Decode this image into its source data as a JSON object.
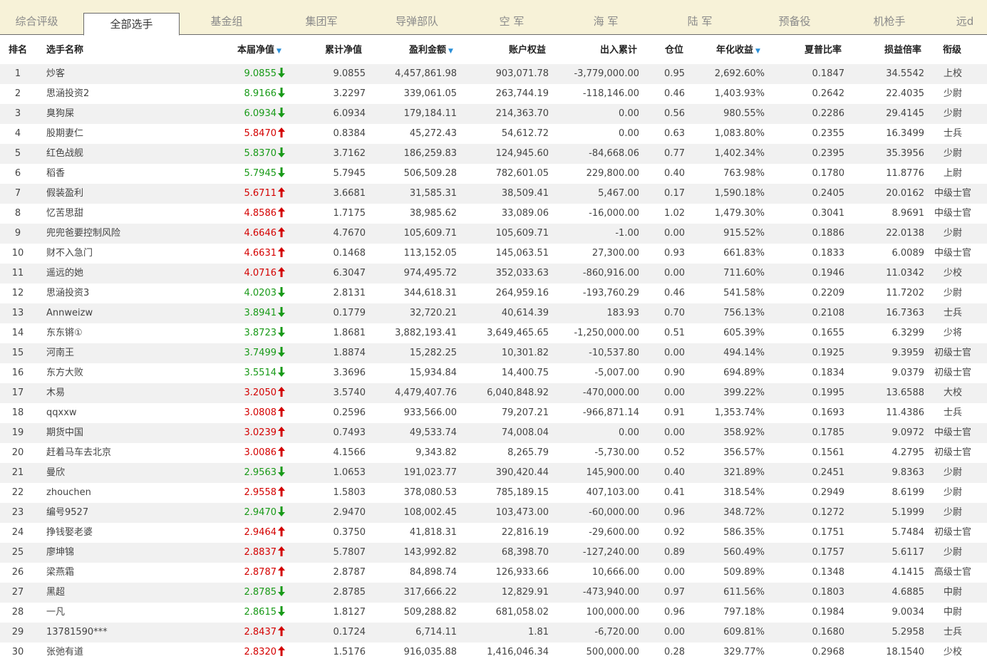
{
  "tabs": [
    "综合评级",
    "全部选手",
    "基金组",
    "集团军",
    "导弹部队",
    "空 军",
    "海 军",
    "陆 军",
    "预备役",
    "机枪手",
    "远d"
  ],
  "active_tab": 1,
  "headers": {
    "rank": "排名",
    "name": "选手名称",
    "nav": "本届净值",
    "cum_nav": "累计净值",
    "profit": "盈利金额",
    "equity": "账户权益",
    "inout": "出入累计",
    "position": "仓位",
    "annual": "年化收益",
    "sharpe": "夏普比率",
    "pl_ratio": "损益倍率",
    "title": "衔级"
  },
  "colors": {
    "up": "#d40000",
    "down": "#189a18",
    "tab_bg": "#f7f2d8",
    "row_alt": "#f1f1f1",
    "sort_arrow": "#2a8fd8"
  },
  "rows": [
    {
      "rank": "1",
      "name": "炒客",
      "nav": "9.0855",
      "dir": "down",
      "cum_nav": "9.0855",
      "profit": "4,457,861.98",
      "equity": "903,071.78",
      "inout": "-3,779,000.00",
      "position": "0.95",
      "annual": "2,692.60%",
      "sharpe": "0.1847",
      "pl_ratio": "34.5542",
      "title": "上校"
    },
    {
      "rank": "2",
      "name": "思涵投资2",
      "nav": "8.9166",
      "dir": "down",
      "cum_nav": "3.2297",
      "profit": "339,061.05",
      "equity": "263,744.19",
      "inout": "-118,146.00",
      "position": "0.46",
      "annual": "1,403.93%",
      "sharpe": "0.2642",
      "pl_ratio": "22.4035",
      "title": "少尉"
    },
    {
      "rank": "3",
      "name": "臭狗屎",
      "nav": "6.0934",
      "dir": "down",
      "cum_nav": "6.0934",
      "profit": "179,184.11",
      "equity": "214,363.70",
      "inout": "0.00",
      "position": "0.56",
      "annual": "980.55%",
      "sharpe": "0.2286",
      "pl_ratio": "29.4145",
      "title": "少尉"
    },
    {
      "rank": "4",
      "name": "股期妻仁",
      "nav": "5.8470",
      "dir": "up",
      "cum_nav": "0.8384",
      "profit": "45,272.43",
      "equity": "54,612.72",
      "inout": "0.00",
      "position": "0.63",
      "annual": "1,083.80%",
      "sharpe": "0.2355",
      "pl_ratio": "16.3499",
      "title": "士兵"
    },
    {
      "rank": "5",
      "name": "红色战舰",
      "nav": "5.8370",
      "dir": "down",
      "cum_nav": "3.7162",
      "profit": "186,259.83",
      "equity": "124,945.60",
      "inout": "-84,668.06",
      "position": "0.77",
      "annual": "1,402.34%",
      "sharpe": "0.2395",
      "pl_ratio": "35.3956",
      "title": "少尉"
    },
    {
      "rank": "6",
      "name": "稻香",
      "nav": "5.7945",
      "dir": "down",
      "cum_nav": "5.7945",
      "profit": "506,509.28",
      "equity": "782,601.05",
      "inout": "229,800.00",
      "position": "0.40",
      "annual": "763.98%",
      "sharpe": "0.1780",
      "pl_ratio": "11.8776",
      "title": "上尉"
    },
    {
      "rank": "7",
      "name": "假装盈利",
      "nav": "5.6711",
      "dir": "up",
      "cum_nav": "3.6681",
      "profit": "31,585.31",
      "equity": "38,509.41",
      "inout": "5,467.00",
      "position": "0.17",
      "annual": "1,590.18%",
      "sharpe": "0.2405",
      "pl_ratio": "20.0162",
      "title": "中级士官"
    },
    {
      "rank": "8",
      "name": "忆苦思甜",
      "nav": "4.8586",
      "dir": "up",
      "cum_nav": "1.7175",
      "profit": "38,985.62",
      "equity": "33,089.06",
      "inout": "-16,000.00",
      "position": "1.02",
      "annual": "1,479.30%",
      "sharpe": "0.3041",
      "pl_ratio": "8.9691",
      "title": "中级士官"
    },
    {
      "rank": "9",
      "name": "兜兜爸要控制风险",
      "nav": "4.6646",
      "dir": "up",
      "cum_nav": "4.7670",
      "profit": "105,609.71",
      "equity": "105,609.71",
      "inout": "-1.00",
      "position": "0.00",
      "annual": "915.52%",
      "sharpe": "0.1886",
      "pl_ratio": "22.0138",
      "title": "少尉"
    },
    {
      "rank": "10",
      "name": "财不入急门",
      "nav": "4.6631",
      "dir": "up",
      "cum_nav": "0.1468",
      "profit": "113,152.05",
      "equity": "145,063.51",
      "inout": "27,300.00",
      "position": "0.93",
      "annual": "661.83%",
      "sharpe": "0.1833",
      "pl_ratio": "6.0089",
      "title": "中级士官"
    },
    {
      "rank": "11",
      "name": "遥远的她",
      "nav": "4.0716",
      "dir": "up",
      "cum_nav": "6.3047",
      "profit": "974,495.72",
      "equity": "352,033.63",
      "inout": "-860,916.00",
      "position": "0.00",
      "annual": "711.60%",
      "sharpe": "0.1946",
      "pl_ratio": "11.0342",
      "title": "少校"
    },
    {
      "rank": "12",
      "name": "思涵投资3",
      "nav": "4.0203",
      "dir": "down",
      "cum_nav": "2.8131",
      "profit": "344,618.31",
      "equity": "264,959.16",
      "inout": "-193,760.29",
      "position": "0.46",
      "annual": "541.58%",
      "sharpe": "0.2209",
      "pl_ratio": "11.7202",
      "title": "少尉"
    },
    {
      "rank": "13",
      "name": "Annweizw",
      "nav": "3.8941",
      "dir": "down",
      "cum_nav": "0.1779",
      "profit": "32,720.21",
      "equity": "40,614.39",
      "inout": "183.93",
      "position": "0.70",
      "annual": "756.13%",
      "sharpe": "0.2108",
      "pl_ratio": "16.7363",
      "title": "士兵"
    },
    {
      "rank": "14",
      "name": "东东锵①",
      "nav": "3.8723",
      "dir": "down",
      "cum_nav": "1.8681",
      "profit": "3,882,193.41",
      "equity": "3,649,465.65",
      "inout": "-1,250,000.00",
      "position": "0.51",
      "annual": "605.39%",
      "sharpe": "0.1655",
      "pl_ratio": "6.3299",
      "title": "少将"
    },
    {
      "rank": "15",
      "name": "河南王",
      "nav": "3.7499",
      "dir": "down",
      "cum_nav": "1.8874",
      "profit": "15,282.25",
      "equity": "10,301.82",
      "inout": "-10,537.80",
      "position": "0.00",
      "annual": "494.14%",
      "sharpe": "0.1925",
      "pl_ratio": "9.3959",
      "title": "初级士官"
    },
    {
      "rank": "16",
      "name": "东方大败",
      "nav": "3.5514",
      "dir": "down",
      "cum_nav": "3.3696",
      "profit": "15,934.84",
      "equity": "14,400.75",
      "inout": "-5,007.00",
      "position": "0.90",
      "annual": "694.89%",
      "sharpe": "0.1834",
      "pl_ratio": "9.0379",
      "title": "初级士官"
    },
    {
      "rank": "17",
      "name": "木易",
      "nav": "3.2050",
      "dir": "up",
      "cum_nav": "3.5740",
      "profit": "4,479,407.76",
      "equity": "6,040,848.92",
      "inout": "-470,000.00",
      "position": "0.00",
      "annual": "399.22%",
      "sharpe": "0.1995",
      "pl_ratio": "13.6588",
      "title": "大校"
    },
    {
      "rank": "18",
      "name": "qqxxw",
      "nav": "3.0808",
      "dir": "up",
      "cum_nav": "0.2596",
      "profit": "933,566.00",
      "equity": "79,207.21",
      "inout": "-966,871.14",
      "position": "0.91",
      "annual": "1,353.74%",
      "sharpe": "0.1693",
      "pl_ratio": "11.4386",
      "title": "士兵"
    },
    {
      "rank": "19",
      "name": "期货中国",
      "nav": "3.0239",
      "dir": "up",
      "cum_nav": "0.7493",
      "profit": "49,533.74",
      "equity": "74,008.04",
      "inout": "0.00",
      "position": "0.00",
      "annual": "358.92%",
      "sharpe": "0.1785",
      "pl_ratio": "9.0972",
      "title": "中级士官"
    },
    {
      "rank": "20",
      "name": "赶着马车去北京",
      "nav": "3.0086",
      "dir": "up",
      "cum_nav": "4.1566",
      "profit": "9,343.82",
      "equity": "8,265.79",
      "inout": "-5,730.00",
      "position": "0.52",
      "annual": "356.57%",
      "sharpe": "0.1561",
      "pl_ratio": "4.2795",
      "title": "初级士官"
    },
    {
      "rank": "21",
      "name": "曼欣",
      "nav": "2.9563",
      "dir": "down",
      "cum_nav": "1.0653",
      "profit": "191,023.77",
      "equity": "390,420.44",
      "inout": "145,900.00",
      "position": "0.40",
      "annual": "321.89%",
      "sharpe": "0.2451",
      "pl_ratio": "9.8363",
      "title": "少尉"
    },
    {
      "rank": "22",
      "name": "zhouchen",
      "nav": "2.9558",
      "dir": "up",
      "cum_nav": "1.5803",
      "profit": "378,080.53",
      "equity": "785,189.15",
      "inout": "407,103.00",
      "position": "0.41",
      "annual": "318.54%",
      "sharpe": "0.2949",
      "pl_ratio": "8.6199",
      "title": "少尉"
    },
    {
      "rank": "23",
      "name": "编号9527",
      "nav": "2.9470",
      "dir": "down",
      "cum_nav": "2.9470",
      "profit": "108,002.45",
      "equity": "103,473.00",
      "inout": "-60,000.00",
      "position": "0.96",
      "annual": "348.72%",
      "sharpe": "0.1272",
      "pl_ratio": "5.1999",
      "title": "少尉"
    },
    {
      "rank": "24",
      "name": "挣钱娶老婆",
      "nav": "2.9464",
      "dir": "up",
      "cum_nav": "0.3750",
      "profit": "41,818.31",
      "equity": "22,816.19",
      "inout": "-29,600.00",
      "position": "0.92",
      "annual": "586.35%",
      "sharpe": "0.1751",
      "pl_ratio": "5.7484",
      "title": "初级士官"
    },
    {
      "rank": "25",
      "name": "廖坤锦",
      "nav": "2.8837",
      "dir": "up",
      "cum_nav": "5.7807",
      "profit": "143,992.82",
      "equity": "68,398.70",
      "inout": "-127,240.00",
      "position": "0.89",
      "annual": "560.49%",
      "sharpe": "0.1757",
      "pl_ratio": "5.6117",
      "title": "少尉"
    },
    {
      "rank": "26",
      "name": "梁燕霜",
      "nav": "2.8787",
      "dir": "up",
      "cum_nav": "2.8787",
      "profit": "84,898.74",
      "equity": "126,933.66",
      "inout": "10,666.00",
      "position": "0.00",
      "annual": "509.89%",
      "sharpe": "0.1348",
      "pl_ratio": "4.1415",
      "title": "高级士官"
    },
    {
      "rank": "27",
      "name": "黑超",
      "nav": "2.8785",
      "dir": "down",
      "cum_nav": "2.8785",
      "profit": "317,666.22",
      "equity": "12,829.91",
      "inout": "-473,940.00",
      "position": "0.97",
      "annual": "611.56%",
      "sharpe": "0.1803",
      "pl_ratio": "4.6885",
      "title": "中尉"
    },
    {
      "rank": "28",
      "name": "一凡",
      "nav": "2.8615",
      "dir": "down",
      "cum_nav": "1.8127",
      "profit": "509,288.82",
      "equity": "681,058.02",
      "inout": "100,000.00",
      "position": "0.96",
      "annual": "797.18%",
      "sharpe": "0.1984",
      "pl_ratio": "9.0034",
      "title": "中尉"
    },
    {
      "rank": "29",
      "name": "13781590***",
      "nav": "2.8437",
      "dir": "up",
      "cum_nav": "0.1724",
      "profit": "6,714.11",
      "equity": "1.81",
      "inout": "-6,720.00",
      "position": "0.00",
      "annual": "609.81%",
      "sharpe": "0.1680",
      "pl_ratio": "5.2958",
      "title": "士兵"
    },
    {
      "rank": "30",
      "name": "张弛有道",
      "nav": "2.8320",
      "dir": "up",
      "cum_nav": "1.5176",
      "profit": "916,035.88",
      "equity": "1,416,046.34",
      "inout": "500,000.00",
      "position": "0.28",
      "annual": "329.77%",
      "sharpe": "0.2968",
      "pl_ratio": "18.1540",
      "title": "少校"
    }
  ]
}
